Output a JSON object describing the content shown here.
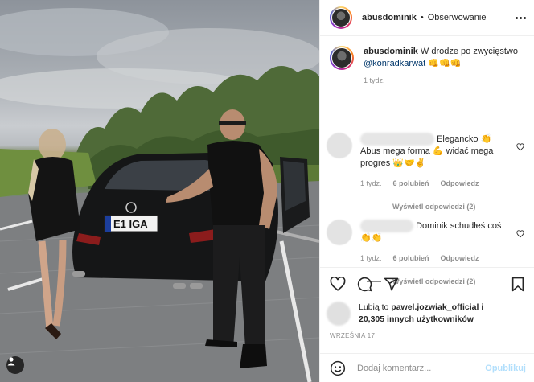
{
  "post": {
    "username": "abusdominik",
    "dot": "•",
    "follow_label": "Obserwowanie",
    "caption_text": "W drodze po zwycięstwo",
    "caption_mention": "@konradkarwat",
    "caption_emoji": "👊👊👊",
    "caption_time": "1 tydz.",
    "plate_text": "E1 IGA",
    "date": "WRZEŚNIA 17"
  },
  "comments": [
    {
      "text_line1": "Elegancko 👏",
      "text_rest": "Abus mega forma 💪 widać mega progres 👑🤝✌️",
      "time": "1 tydz.",
      "likes": "6 polubień",
      "reply_label": "Odpowiedz",
      "view_replies": "Wyświetl odpowiedzi (2)"
    },
    {
      "text_line1": "Dominik schudłeś coś",
      "text_rest": "👏👏",
      "time": "1 tydz.",
      "likes": "6 polubień",
      "reply_label": "Odpowiedz",
      "view_replies": "Wyświetl odpowiedzi (2)"
    }
  ],
  "likes": {
    "prefix": "Lubią to",
    "user": "pawel.jozwiak_official",
    "connector": "i",
    "count_text": "20,305 innych użytkowników"
  },
  "add_comment": {
    "placeholder": "Dodaj komentarz...",
    "publish_label": "Opublikuj"
  },
  "icons": {
    "more": "more-dots-icon",
    "like": "heart-icon",
    "comment": "comment-bubble-icon",
    "share": "paper-plane-icon",
    "save": "bookmark-icon",
    "emoji": "smiley-icon",
    "tagged_user": "user-icon"
  },
  "colors": {
    "text": "#262626",
    "muted": "#8e8e8e",
    "link": "#00376b",
    "publish_disabled": "#b2dffc"
  }
}
